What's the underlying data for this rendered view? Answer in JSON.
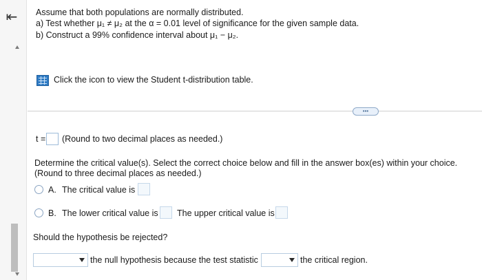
{
  "nav": {
    "back_glyph": "⇤"
  },
  "problem": {
    "line1": "Assume that both populations are normally distributed.",
    "part_a": "a) Test whether μ₁ ≠ μ₂ at the α = 0.01 level of significance for the given sample data.",
    "part_b": "b) Construct a 99% confidence interval about μ₁ − μ₂."
  },
  "table_link": {
    "text": "Click the icon to view the Student t-distribution table."
  },
  "more_button": {
    "label": "•••"
  },
  "test_stat": {
    "prefix": "t =",
    "hint": "(Round to two decimal places as needed.)"
  },
  "critical": {
    "instruction_1": "Determine the critical value(s). Select the correct choice below and fill in the answer box(es) within your choice.",
    "instruction_2": "(Round to three decimal places as needed.)",
    "option_a_letter": "A.",
    "option_a_text": "The critical value is",
    "option_b_letter": "B.",
    "option_b_text_1": "The lower critical value is",
    "option_b_text_2": "The upper critical value is"
  },
  "decision": {
    "question": "Should the hypothesis be rejected?",
    "text_1": "the null hypothesis because the test statistic",
    "text_2": "the critical region."
  },
  "colors": {
    "accent_blue": "#2f7bc4",
    "box_border": "#9dbbd9"
  },
  "icons": [
    "back-arrow-icon",
    "table-grid-icon",
    "dropdown-arrow-icon",
    "radio-icon"
  ]
}
